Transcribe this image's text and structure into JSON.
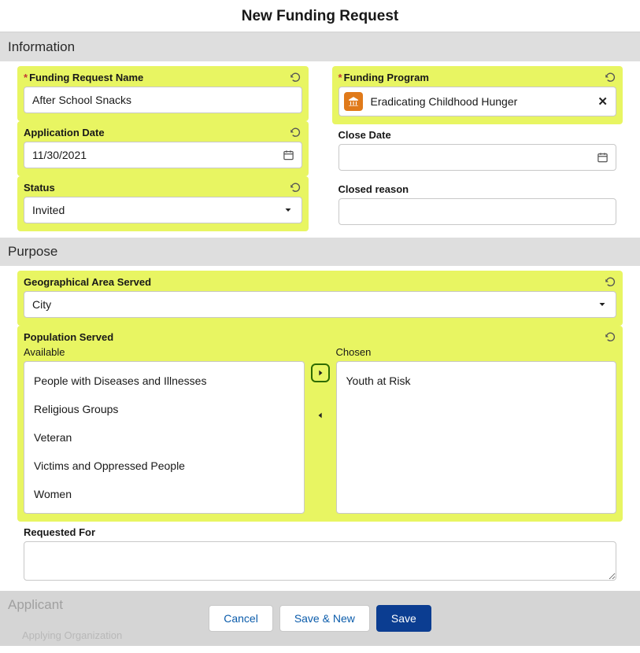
{
  "page": {
    "title": "New Funding Request"
  },
  "sections": {
    "information": "Information",
    "purpose": "Purpose",
    "applicant": "Applicant",
    "applicant_sub": "Applying Organization"
  },
  "info": {
    "request_name": {
      "label": "Funding Request Name",
      "value": "After School Snacks",
      "required": true
    },
    "application_date": {
      "label": "Application Date",
      "value": "11/30/2021"
    },
    "status": {
      "label": "Status",
      "value": "Invited"
    },
    "funding_program": {
      "label": "Funding Program",
      "value": "Eradicating Childhood Hunger",
      "required": true
    },
    "close_date": {
      "label": "Close Date",
      "value": ""
    },
    "closed_reason": {
      "label": "Closed reason",
      "value": ""
    }
  },
  "purpose": {
    "geo": {
      "label": "Geographical Area Served",
      "value": "City"
    },
    "population": {
      "label": "Population Served",
      "available_label": "Available",
      "chosen_label": "Chosen",
      "available": [
        "People with Diseases and Illnesses",
        "Religious Groups",
        "Veteran",
        "Victims and Oppressed People",
        "Women"
      ],
      "chosen": [
        "Youth at Risk"
      ]
    },
    "requested_for": {
      "label": "Requested For",
      "value": ""
    }
  },
  "footer": {
    "cancel": "Cancel",
    "save_new": "Save & New",
    "save": "Save"
  }
}
